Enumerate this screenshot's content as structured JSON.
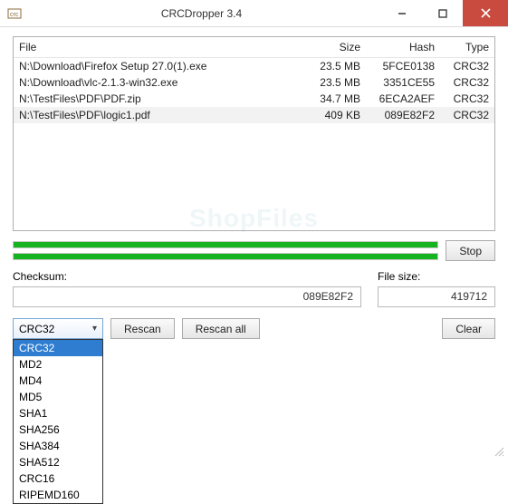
{
  "window": {
    "title": "CRCDropper 3.4",
    "icon_name": "crc-app-icon"
  },
  "columns": {
    "file": "File",
    "size": "Size",
    "hash": "Hash",
    "type": "Type"
  },
  "rows": [
    {
      "file": "N:\\Download\\Firefox Setup 27.0(1).exe",
      "size": "23.5 MB",
      "hash": "5FCE0138",
      "type": "CRC32",
      "selected": false
    },
    {
      "file": "N:\\Download\\vlc-2.1.3-win32.exe",
      "size": "23.5 MB",
      "hash": "3351CE55",
      "type": "CRC32",
      "selected": false
    },
    {
      "file": "N:\\TestFiles\\PDF\\PDF.zip",
      "size": "34.7 MB",
      "hash": "6ECA2AEF",
      "type": "CRC32",
      "selected": false
    },
    {
      "file": "N:\\TestFiles\\PDF\\logic1.pdf",
      "size": "409 KB",
      "hash": "089E82F2",
      "type": "CRC32",
      "selected": true
    }
  ],
  "buttons": {
    "stop": "Stop",
    "rescan": "Rescan",
    "rescan_all": "Rescan all",
    "clear": "Clear"
  },
  "labels": {
    "checksum": "Checksum:",
    "filesize": "File size:"
  },
  "values": {
    "checksum": "089E82F2",
    "filesize": "419712"
  },
  "algorithm": {
    "selected": "CRC32",
    "options": [
      "CRC32",
      "MD2",
      "MD4",
      "MD5",
      "SHA1",
      "SHA256",
      "SHA384",
      "SHA512",
      "CRC16",
      "RIPEMD160"
    ]
  },
  "progress": {
    "bar1": 100,
    "bar2": 100
  },
  "colors": {
    "accent": "#16b321",
    "close": "#c94b3f",
    "select_highlight": "#2f7dd1"
  }
}
